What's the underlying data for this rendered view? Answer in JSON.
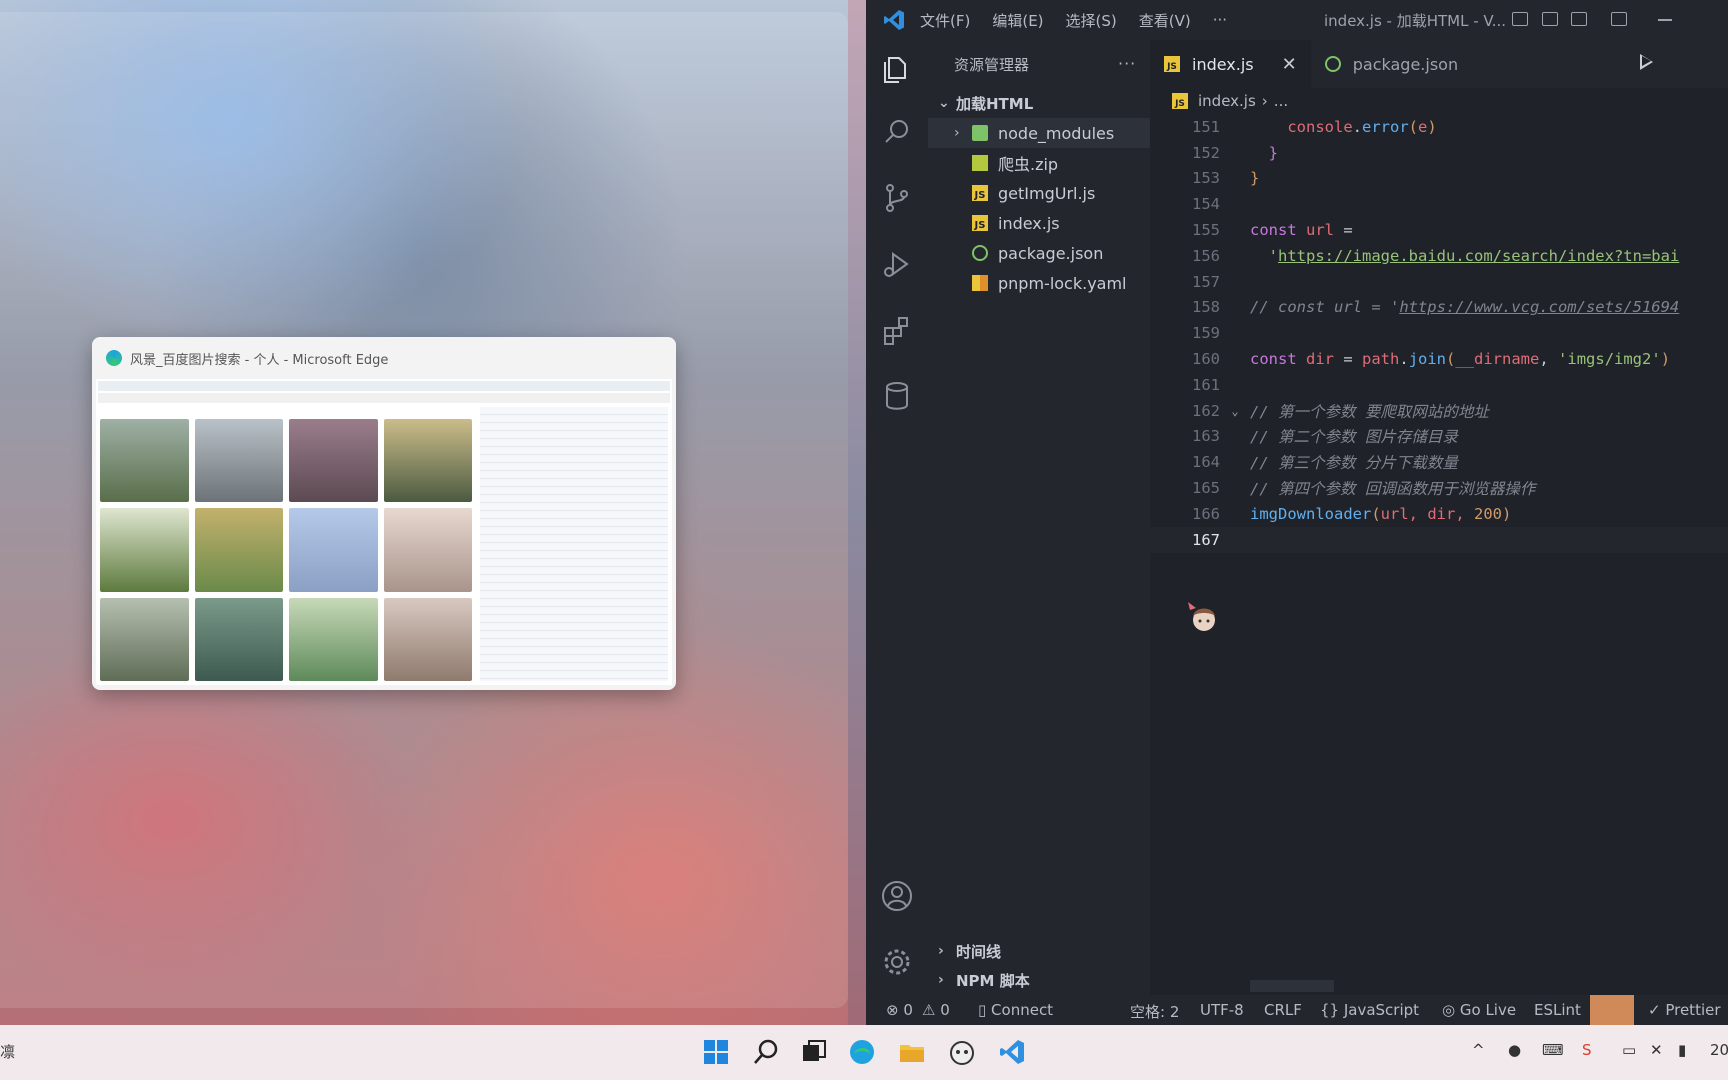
{
  "preview": {
    "title": "风景_百度图片搜索 - 个人 - Microsoft Edge"
  },
  "titlebar": {
    "menu": [
      "文件(F)",
      "编辑(E)",
      "选择(S)",
      "查看(V)",
      "···"
    ],
    "title": "index.js - 加载HTML - V..."
  },
  "sidebar": {
    "header": "资源管理器",
    "more": "···",
    "folder": "加载HTML",
    "items": [
      {
        "name": "node_modules",
        "icon": "folder-icon",
        "type": "folder"
      },
      {
        "name": "爬虫.zip",
        "icon": "zip-icon",
        "type": "file"
      },
      {
        "name": "getImgUrl.js",
        "icon": "js-icon",
        "type": "file"
      },
      {
        "name": "index.js",
        "icon": "js-icon",
        "type": "file"
      },
      {
        "name": "package.json",
        "icon": "json-icon",
        "type": "file"
      },
      {
        "name": "pnpm-lock.yaml",
        "icon": "yaml-icon",
        "type": "file"
      }
    ],
    "timeline": "时间线",
    "npm": "NPM 脚本"
  },
  "tabs": [
    {
      "label": "index.js",
      "active": true
    },
    {
      "label": "package.json",
      "active": false
    }
  ],
  "breadcrumb": {
    "file": "index.js",
    "rest": "..."
  },
  "code": {
    "line_numbers": [
      "151",
      "152",
      "153",
      "154",
      "155",
      "156",
      "157",
      "158",
      "159",
      "160",
      "161",
      "162",
      "163",
      "164",
      "165",
      "166",
      "167"
    ],
    "l151": {
      "a": "console",
      "b": ".",
      "c": "error",
      "d": "(",
      "e": "e",
      "f": ")"
    },
    "l152": "}",
    "l153": "}",
    "l155": {
      "kw": "const",
      "name": "url",
      "op": " ="
    },
    "l156": {
      "q": "'",
      "url": "https://image.baidu.com/search/index?tn=bai"
    },
    "l158": {
      "pre": "// const url = '",
      "url": "https://www.vcg.com/sets/51694"
    },
    "l160": {
      "kw": "const",
      "name": "dir",
      "op": " = ",
      "obj": "path",
      "fn": "join",
      "open": "(",
      "arg1": "__dirname",
      "comma": ", ",
      "arg2": "'imgs/img2'",
      "close": ")"
    },
    "l162": "// 第一个参数 要爬取网站的地址",
    "l163": "// 第二个参数 图片存储目录",
    "l164": "// 第三个参数 分片下载数量",
    "l165": "// 第四个参数 回调函数用于浏览器操作",
    "l166": {
      "fn": "imgDownloader",
      "open": "(",
      "args": "url, dir, ",
      "num": "200",
      "close": ")"
    }
  },
  "statusbar": {
    "errors": "⊗ 0",
    "warnings": "⚠ 0",
    "connect": "Connect",
    "spaces": "空格: 2",
    "encoding": "UTF-8",
    "eol": "CRLF",
    "language": "{} JavaScript",
    "golive": "Go Live",
    "eslint": "ESLint",
    "prettier": "✓ Prettier"
  },
  "taskbar": {
    "left_text": "凛",
    "time_fragment": "20"
  },
  "colors": {
    "editor_bg": "#1f2228",
    "sidebar_bg": "#23262d",
    "keyword": "#c678dd",
    "function": "#61afef",
    "string": "#98c379",
    "number": "#d19a66",
    "variable": "#e06c75",
    "comment": "#7f848e"
  }
}
